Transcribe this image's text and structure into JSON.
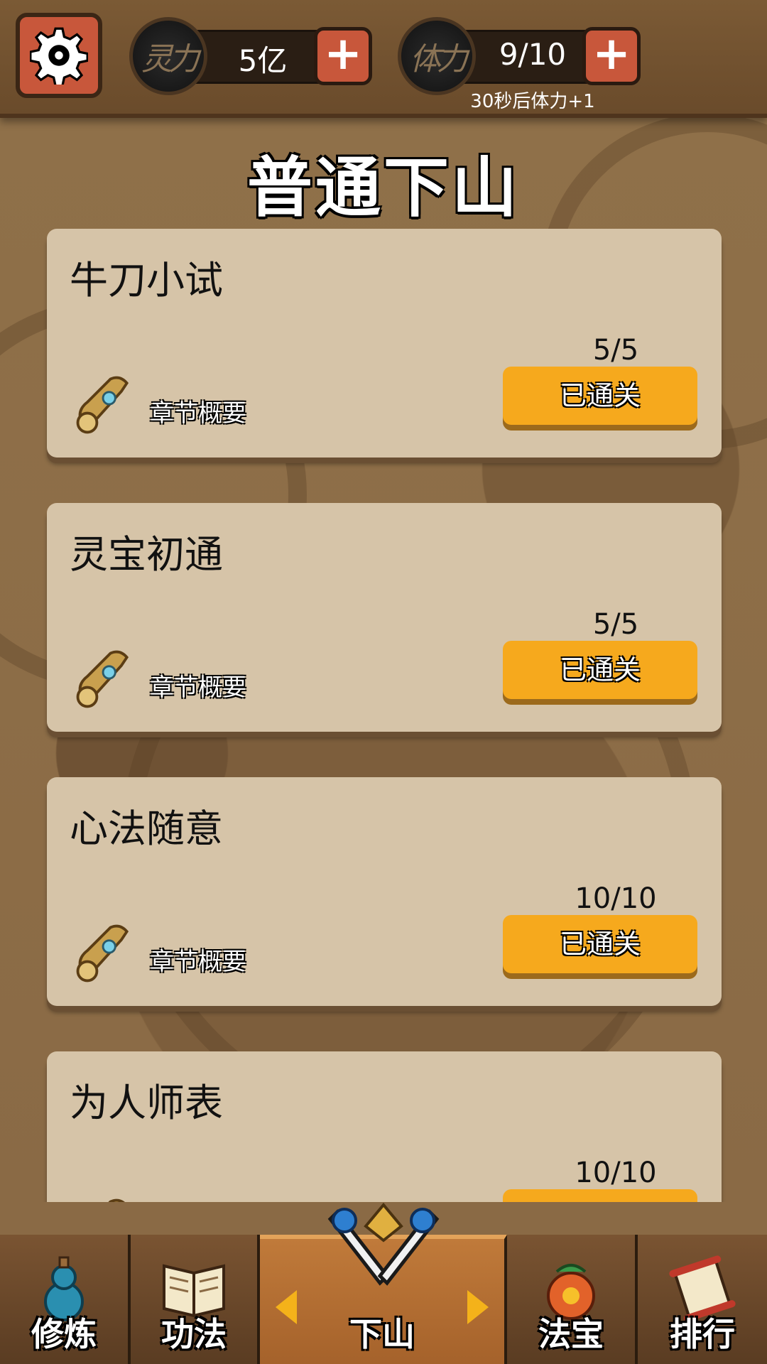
{
  "header": {
    "spirit": {
      "badge": "灵力",
      "value": "5亿"
    },
    "stamina": {
      "badge": "体力",
      "value": "9/10",
      "regen_text": "30秒后体力+1"
    }
  },
  "page_title": "普通下山",
  "chapters": [
    {
      "title": "牛刀小试",
      "progress": "5/5",
      "button": "已通关",
      "summary": "章节概要"
    },
    {
      "title": "灵宝初通",
      "progress": "5/5",
      "button": "已通关",
      "summary": "章节概要"
    },
    {
      "title": "心法随意",
      "progress": "10/10",
      "button": "已通关",
      "summary": "章节概要"
    },
    {
      "title": "为人师表",
      "progress": "10/10",
      "button": "",
      "summary": ""
    }
  ],
  "nav": {
    "items": [
      {
        "label": "修炼",
        "icon": "gourd-icon"
      },
      {
        "label": "功法",
        "icon": "book-icon"
      },
      {
        "label": "下山",
        "icon": "crossed-swords-icon"
      },
      {
        "label": "法宝",
        "icon": "treasure-bag-icon"
      },
      {
        "label": "排行",
        "icon": "scroll-ranking-icon"
      }
    ],
    "active": "下山"
  },
  "colors": {
    "accent_button": "#f6a91d",
    "plus_button": "#c8573b",
    "card_bg": "#d6c4a8",
    "nav_active": "#b06a30"
  }
}
